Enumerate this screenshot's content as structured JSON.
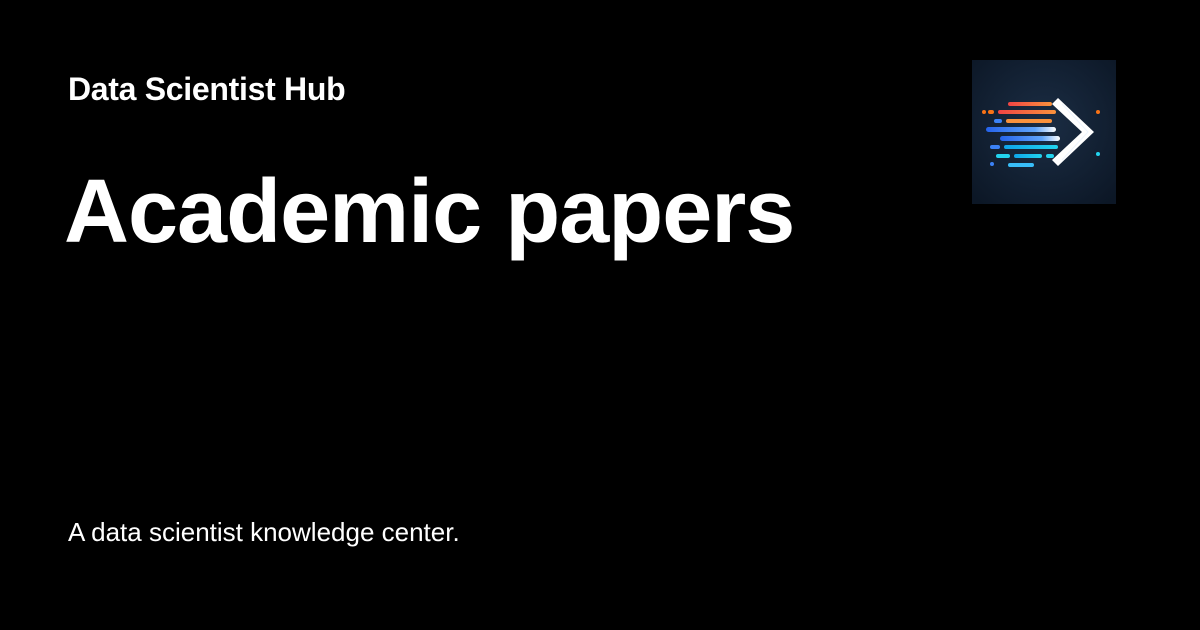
{
  "site": {
    "name": "Data Scientist Hub"
  },
  "page": {
    "title": "Academic papers",
    "tagline": "A data scientist knowledge center."
  },
  "logo": {
    "icon": "forward-arrow-speed-lines-icon",
    "background_color": "#0f1e30",
    "accent_colors": [
      "#f0613a",
      "#3b82f6",
      "#22d3ee",
      "#ffffff"
    ]
  },
  "colors": {
    "background": "#000000",
    "text": "#ffffff"
  }
}
